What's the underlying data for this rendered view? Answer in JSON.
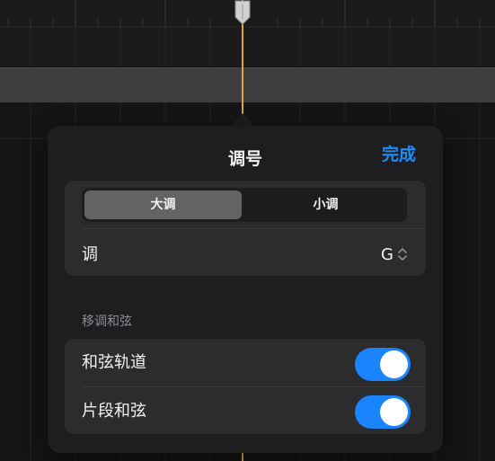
{
  "popover": {
    "title": "调号",
    "done_label": "完成"
  },
  "key_signature": {
    "segments": [
      {
        "label": "大调",
        "selected": true
      },
      {
        "label": "小调",
        "selected": false
      }
    ],
    "key_label": "调",
    "key_value": "G"
  },
  "transpose": {
    "section_header": "移调和弦",
    "rows": [
      {
        "label": "和弦轨道",
        "on": true
      },
      {
        "label": "片段和弦",
        "on": true
      }
    ]
  },
  "colors": {
    "accent": "#1a8cff",
    "toggle_on": "#1a84ff",
    "playhead": "#d8a92b",
    "popover_bg": "#1e1e20",
    "card_bg": "#2c2c2e"
  },
  "icons": {
    "playhead_handle": "playhead-handle-icon",
    "key_stepper": "chevron-up-down-icon"
  }
}
